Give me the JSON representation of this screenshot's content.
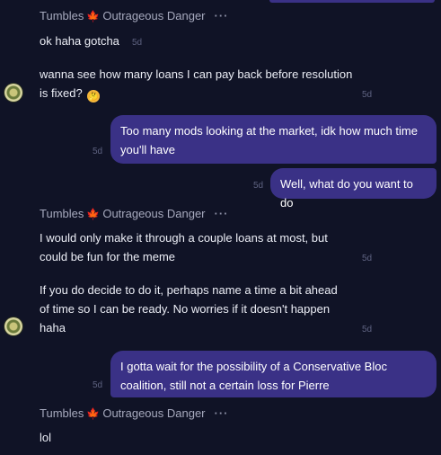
{
  "sender": {
    "name": "Tumbles",
    "flag": "🍁",
    "title": "Outrageous Danger",
    "more": "···"
  },
  "messages": [
    {
      "text": "ok haha gotcha",
      "time": "5d"
    },
    {
      "line1": "wanna see how many loans I can pay back before resolution",
      "line2": "is fixed?",
      "emoji": "thinking-face-emoji",
      "time": "5d"
    },
    {
      "line1": "Too many mods looking at the market, idk how much time",
      "line2": "you'll have",
      "time": "5d"
    },
    {
      "text": "Well, what do you want to do",
      "time": "5d"
    },
    {
      "line1": "I would only make it through a couple loans at most, but",
      "line2": "could be fun for the meme",
      "time": "5d"
    },
    {
      "line1": "If you do decide to do it, perhaps name a time a bit ahead",
      "line2": "of time so I can be ready. No worries if it doesn't happen",
      "line3": "haha",
      "time": "5d"
    },
    {
      "line1": "I gotta wait for the possibility of a Conservative Bloc",
      "line2": "coalition, still not a certain loss for Pierre",
      "time": "5d"
    },
    {
      "text": "lol"
    }
  ],
  "colors": {
    "background": "#101326",
    "outgoing_bubble": "#3a3186",
    "flag": "#e0272d"
  }
}
